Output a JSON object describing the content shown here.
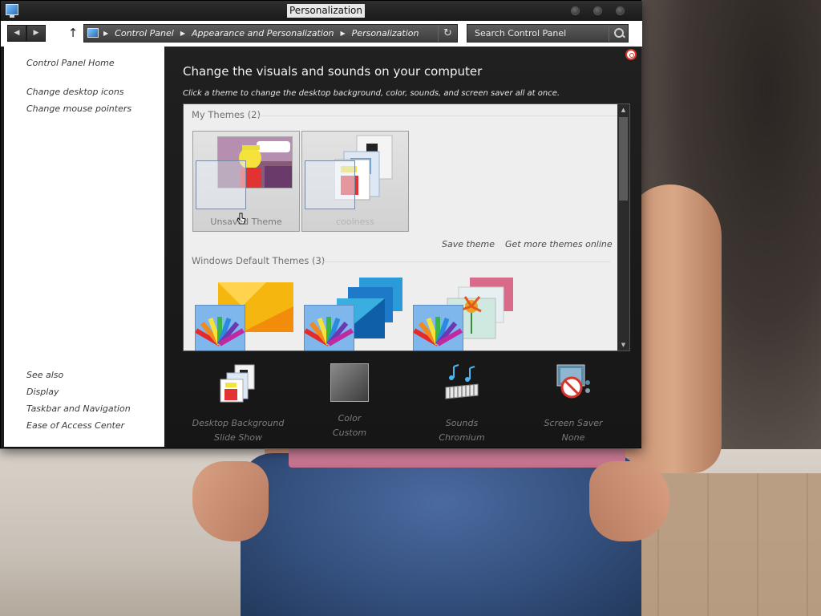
{
  "window": {
    "title": "Personalization",
    "nav": {
      "back_icon": "back-arrow-icon",
      "forward_icon": "forward-arrow-icon",
      "up_icon": "up-arrow-icon",
      "breadcrumbs": [
        "Control Panel",
        "Appearance and Personalization",
        "Personalization"
      ],
      "search_placeholder": "Search Control Panel"
    }
  },
  "sidebar": {
    "home": "Control Panel Home",
    "links": [
      "Change desktop icons",
      "Change mouse pointers"
    ],
    "see_also_label": "See also",
    "see_also": [
      "Display",
      "Taskbar and Navigation",
      "Ease of Access Center"
    ]
  },
  "main": {
    "heading": "Change the visuals and sounds on your computer",
    "subheading": "Click a theme to change the desktop background, color, sounds, and screen saver all at once.",
    "my_themes": {
      "title": "My Themes (2)",
      "items": [
        {
          "label": "Unsaved Theme"
        },
        {
          "label": "coolness"
        }
      ]
    },
    "actions": {
      "save": "Save theme",
      "more": "Get more themes online"
    },
    "default_themes": {
      "title": "Windows Default Themes (3)",
      "count": 3
    }
  },
  "bottom": [
    {
      "title": "Desktop Background",
      "sub": "Slide Show",
      "icon": "desktop-background-icon"
    },
    {
      "title": "Color",
      "sub": "Custom",
      "icon": "color-swatch-icon"
    },
    {
      "title": "Sounds",
      "sub": "Chromium",
      "icon": "sounds-icon"
    },
    {
      "title": "Screen Saver",
      "sub": "None",
      "icon": "screen-saver-icon"
    }
  ],
  "colors": {
    "title_bg": "#1a1a1a",
    "panel_bg": "#1c1c1c",
    "sidebar_bg": "#ffffff",
    "theme_box_bg": "#eeeeee",
    "palette_blue": "#7fb6ec"
  }
}
